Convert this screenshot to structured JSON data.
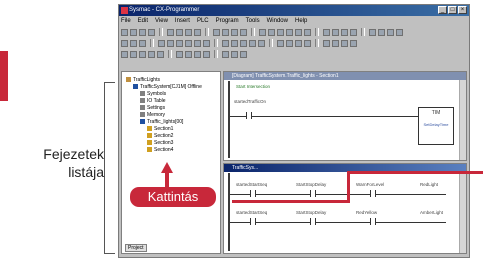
{
  "caption": {
    "line1": "Fejezetek",
    "line2": "listája"
  },
  "callout": {
    "label": "Kattintás"
  },
  "window": {
    "title": "Sysmac - CX-Programmer",
    "menu": [
      "File",
      "Edit",
      "View",
      "Insert",
      "PLC",
      "Program",
      "Tools",
      "Window",
      "Help"
    ]
  },
  "project_tree": {
    "items": [
      {
        "label": "TrafficLights",
        "indent": 0,
        "icon_color": "#c09040"
      },
      {
        "label": "TrafficSystem[CJ1M] Offline",
        "indent": 1,
        "icon_color": "#2050a0"
      },
      {
        "label": "Symbols",
        "indent": 2,
        "icon_color": "#808080"
      },
      {
        "label": "IO Table",
        "indent": 2,
        "icon_color": "#808080"
      },
      {
        "label": "Settings",
        "indent": 2,
        "icon_color": "#808080"
      },
      {
        "label": "Memory",
        "indent": 2,
        "icon_color": "#808080"
      },
      {
        "label": "Traffic_lights[00]",
        "indent": 2,
        "icon_color": "#2050a0"
      },
      {
        "label": "Section1",
        "indent": 3,
        "icon_color": "#d0a020"
      },
      {
        "label": "Section2",
        "indent": 3,
        "icon_color": "#d0a020"
      },
      {
        "label": "Section3",
        "indent": 3,
        "icon_color": "#d0a020"
      },
      {
        "label": "Section4",
        "indent": 3,
        "icon_color": "#d0a020"
      }
    ],
    "tab_label": "Project"
  },
  "ladder_top": {
    "title": "[Diagram] TrafficSystem.Traffic_lights - Section1",
    "rung_comment": "Start Intersection",
    "contact_label": "startedTrafficOn",
    "timer_label": "TIM",
    "timer_sub": "SetDelayTime"
  },
  "ladder_bottom": {
    "title": "TrafficSys...",
    "contacts": [
      "startedStartSeq",
      "StartStopDelay",
      "WarnForLevel",
      "startedStartSeq",
      "StartStopDelay",
      "RedYellow"
    ],
    "coils": [
      "RedLight",
      "AmberLight"
    ]
  },
  "colors": {
    "accent": "#c8283a",
    "title_bar": "#0a246a"
  }
}
